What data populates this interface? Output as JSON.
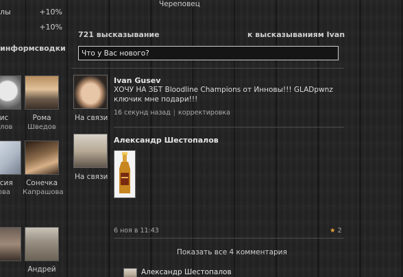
{
  "header": {
    "city": "Череповец"
  },
  "left": {
    "stats": [
      {
        "name": "лы",
        "value": "+10%"
      },
      {
        "name": "",
        "value": "+10%"
      }
    ],
    "section_title": "информсводки",
    "friends": [
      {
        "name": "ис",
        "sub": "илов"
      },
      {
        "name": "Рома",
        "sub": "Шведов"
      },
      {
        "name": "асия",
        "sub": "ова"
      },
      {
        "name": "Сонечка",
        "sub": "Капрашова"
      },
      {
        "name": "",
        "sub": ""
      },
      {
        "name": "Андрей",
        "sub": ""
      }
    ]
  },
  "wall": {
    "count": "721 высказывание",
    "link": "к высказываниям Ivan",
    "status_placeholder": "Что у Вас нового?"
  },
  "posts": [
    {
      "author": "Ivan Gusev",
      "status": "На связи",
      "text": "ХОЧУ НА ЗБТ Bloodline Champions от Инновы!!! GLADpwnz ключик мне подари!!!",
      "time": "16 секунд назад",
      "action": "корректировка"
    },
    {
      "author": "Александр Шестопалов",
      "status": "На связи",
      "time": "6 ноя в 11:43",
      "likes_icon": "★",
      "likes": "2",
      "show_comments": "Показать все 4 комментария",
      "comment_author": "Александр Шестопалов"
    }
  ]
}
